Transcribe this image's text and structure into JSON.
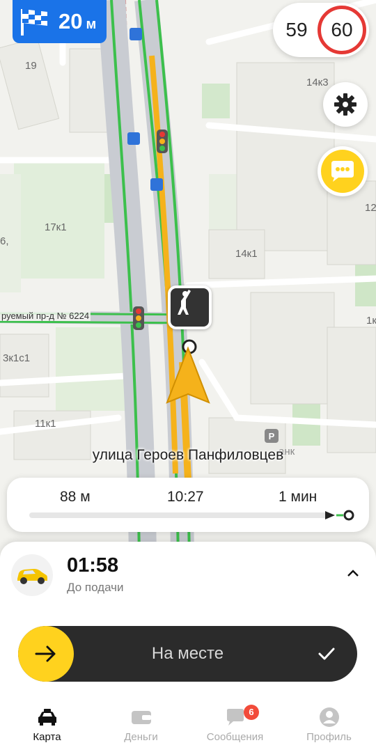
{
  "maneuver": {
    "distance_value": "20",
    "distance_unit": "м",
    "icon": "finish-flag-icon"
  },
  "speed": {
    "current": "59",
    "limit": "60",
    "limit_color": "#e53935"
  },
  "map": {
    "labels": [
      "19",
      "14к3",
      "17к1",
      "6,",
      "14к1",
      "1к",
      "3к1с1",
      "11к1",
      "12"
    ],
    "side_street": "руемый пр-д № 6224",
    "current_street": "улица Героев Панфиловцев",
    "poi_partial": "анк",
    "route_color": "#f5b21b",
    "traffic_free_color": "#3cc04c",
    "heading_arrow_color": "#f5b21b"
  },
  "route_summary": {
    "distance_left": "88 м",
    "arrival_time": "10:27",
    "time_left": "1 мин",
    "progress_fraction": 0.98
  },
  "order": {
    "eta": "01:58",
    "eta_caption": "До подачи",
    "car_icon": "yellow-taxi-icon"
  },
  "action": {
    "slider_label": "На месте",
    "accent_color": "#ffd21e"
  },
  "tabs": [
    {
      "label": "Карта",
      "icon": "taxi-car-icon",
      "active": true
    },
    {
      "label": "Деньги",
      "icon": "wallet-icon",
      "active": false
    },
    {
      "label": "Сообщения",
      "icon": "chat-bubble-icon",
      "active": false,
      "badge": "6"
    },
    {
      "label": "Профиль",
      "icon": "profile-icon",
      "active": false
    }
  ]
}
